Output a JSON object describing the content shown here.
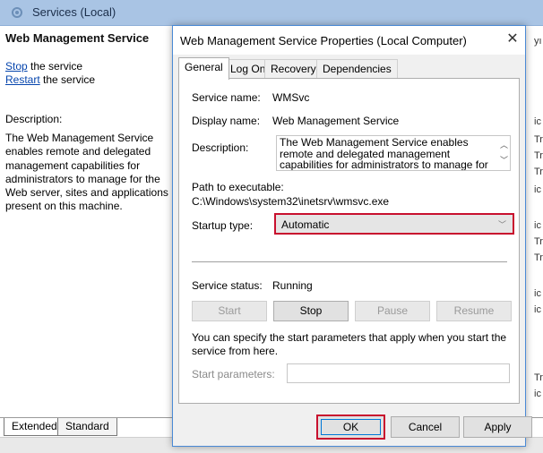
{
  "background": {
    "header_title": "Services (Local)",
    "service_name": "Web Management Service",
    "stop_link": "Stop",
    "stop_suffix": " the service",
    "restart_link": "Restart",
    "restart_suffix": " the service",
    "description_label": "Description:",
    "description": "The Web Management Service enables remote and delegated management capabilities for administrators to manage for the Web server, sites and applications present on this machine.",
    "tabs": [
      "Extended",
      "Standard"
    ],
    "right_column_fragments": [
      "yı",
      "ic",
      "Tr",
      "Tr",
      "Tr",
      "ic",
      "ic",
      "Tr",
      "Tr",
      "ic",
      "ic",
      "Tr",
      "ic"
    ]
  },
  "dialog": {
    "title": "Web Management Service Properties (Local Computer)",
    "close_glyph": "✕",
    "tabs": [
      "General",
      "Log On",
      "Recovery",
      "Dependencies"
    ],
    "service_name_label": "Service name:",
    "service_name_value": "WMSvc",
    "display_name_label": "Display name:",
    "display_name_value": "Web Management Service",
    "description_label": "Description:",
    "description_value": "The Web Management Service enables remote and delegated management capabilities for administrators to manage for the Web server, sites",
    "path_label": "Path to executable:",
    "path_value": "C:\\Windows\\system32\\inetsrv\\wmsvc.exe",
    "startup_type_label": "Startup type:",
    "startup_type_value": "Automatic",
    "service_status_label": "Service status:",
    "service_status_value": "Running",
    "buttons": {
      "start": "Start",
      "stop": "Stop",
      "pause": "Pause",
      "resume": "Resume"
    },
    "params_hint": "You can specify the start parameters that apply when you start the service from here.",
    "start_params_label": "Start parameters:",
    "start_params_value": "",
    "ok": "OK",
    "cancel": "Cancel",
    "apply": "Apply"
  },
  "colors": {
    "highlight_border": "#c8102e",
    "link": "#0645ad",
    "header_bg": "#a9c4e4"
  }
}
